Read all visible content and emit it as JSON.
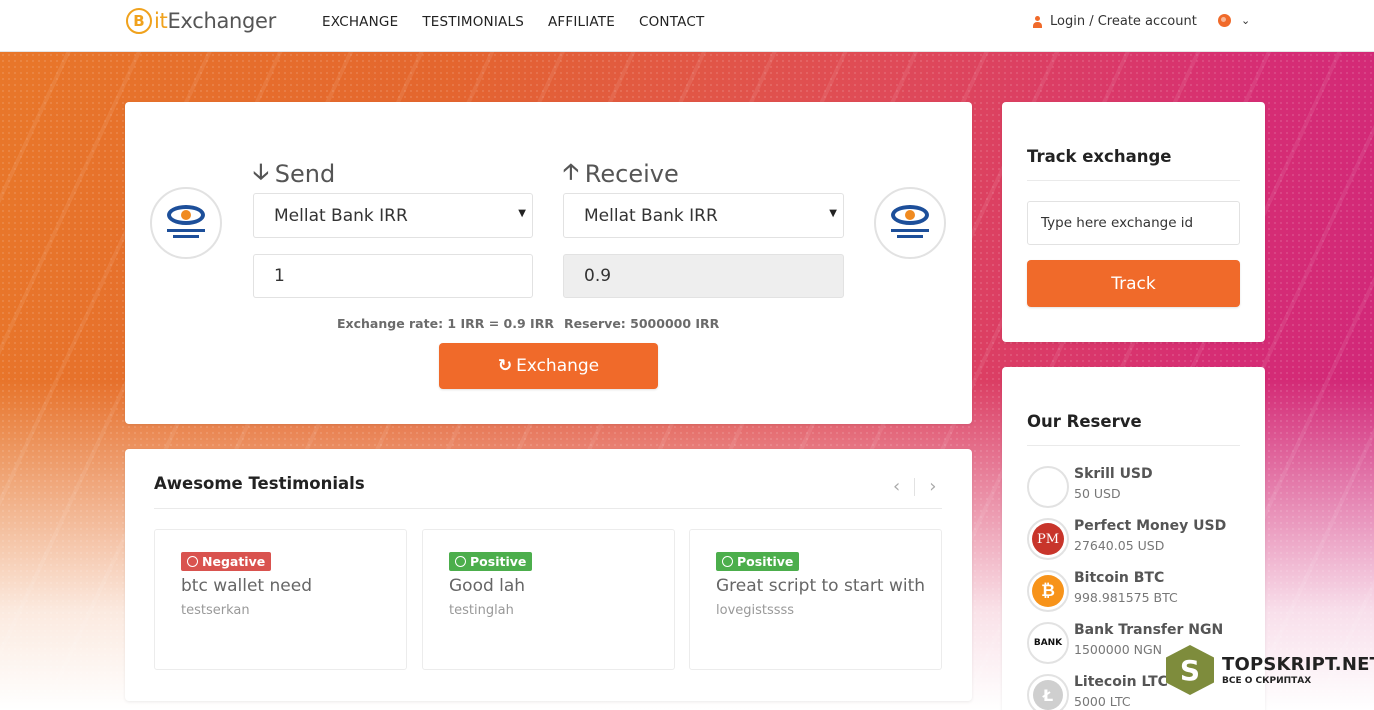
{
  "header": {
    "logo": {
      "coin": "B",
      "text_accent": "it",
      "text_main": "Exchanger"
    },
    "nav": [
      "EXCHANGE",
      "TESTIMONIALS",
      "AFFILIATE",
      "CONTACT"
    ],
    "login_label": "Login / Create account",
    "language_icon": "globe-icon"
  },
  "exchange": {
    "send": {
      "title": "Send",
      "method": "Mellat Bank IRR",
      "amount": "1",
      "note": "Exchange rate: 1 IRR = 0.9 IRR"
    },
    "receive": {
      "title": "Receive",
      "method": "Mellat Bank IRR",
      "amount": "0.9",
      "note": "Reserve: 5000000 IRR"
    },
    "button_label": "Exchange",
    "button_icon": "↻",
    "arrow_down": "🡣",
    "arrow_up": "🡡",
    "caret": "▼"
  },
  "testimonials": {
    "title": "Awesome Testimonials",
    "prev": "‹",
    "next": "›",
    "items": [
      {
        "badge": "Negative",
        "message": "btc wallet need",
        "author": "testserkan"
      },
      {
        "badge": "Positive",
        "message": "Good lah",
        "author": "testinglah"
      },
      {
        "badge": "Positive",
        "message": "Great script to start with",
        "author": "lovegistssss"
      }
    ]
  },
  "track": {
    "title": "Track exchange",
    "input_value": "Type here exchange id",
    "button_label": "Track"
  },
  "reserve": {
    "title": "Our Reserve",
    "items": [
      {
        "name": "Skrill USD",
        "amount": "50 USD"
      },
      {
        "name": "Perfect Money USD",
        "amount": "27640.05 USD",
        "icon_text": "PM"
      },
      {
        "name": "Bitcoin BTC",
        "amount": "998.981575 BTC",
        "icon_text": "₿"
      },
      {
        "name": "Bank Transfer NGN",
        "amount": "1500000 NGN",
        "icon_text": "BANK"
      },
      {
        "name": "Litecoin LTC",
        "amount": "5000 LTC",
        "icon_text": "Ł"
      }
    ]
  },
  "watermark": {
    "letter": "S",
    "main": "TOPSKRIPT.NET",
    "sub": "ВСЕ О СКРИПТАХ"
  },
  "colors": {
    "accent": "#f06a2a",
    "negative": "#d9534f",
    "positive": "#4cae4c"
  }
}
